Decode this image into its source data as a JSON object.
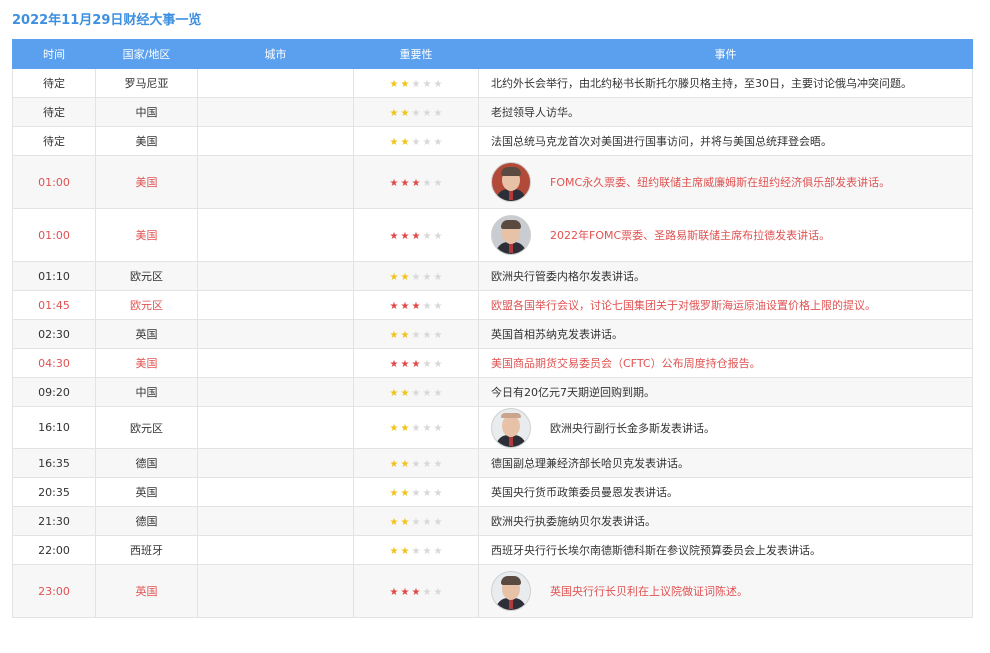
{
  "title": "2022年11月29日财经大事一览",
  "colors": {
    "header_bg": "#5aa0ee",
    "title": "#3d8fe0",
    "important_text": "#e05252",
    "star_low": "#f2c218",
    "star_high": "#e04848"
  },
  "headers": {
    "time": "时间",
    "country": "国家/地区",
    "city": "城市",
    "importance": "重要性",
    "event": "事件"
  },
  "rows": [
    {
      "time": "待定",
      "country": "罗马尼亚",
      "city": "",
      "stars": 2,
      "event": "北约外长会举行，由北约秘书长斯托尔滕贝格主持，至30日，主要讨论俄乌冲突问题。",
      "important": false,
      "avatar": false
    },
    {
      "time": "待定",
      "country": "中国",
      "city": "",
      "stars": 2,
      "event": "老挝领导人访华。",
      "important": false,
      "avatar": false
    },
    {
      "time": "待定",
      "country": "美国",
      "city": "",
      "stars": 2,
      "event": "法国总统马克龙首次对美国进行国事访问，并将与美国总统拜登会晤。",
      "important": false,
      "avatar": false
    },
    {
      "time": "01:00",
      "country": "美国",
      "city": "",
      "stars": 3,
      "event": "FOMC永久票委、纽约联储主席威廉姆斯在纽约经济俱乐部发表讲话。",
      "important": true,
      "avatar": true
    },
    {
      "time": "01:00",
      "country": "美国",
      "city": "",
      "stars": 3,
      "event": "2022年FOMC票委、圣路易斯联储主席布拉德发表讲话。",
      "important": true,
      "avatar": true
    },
    {
      "time": "01:10",
      "country": "欧元区",
      "city": "",
      "stars": 2,
      "event": "欧洲央行管委内格尔发表讲话。",
      "important": false,
      "avatar": false
    },
    {
      "time": "01:45",
      "country": "欧元区",
      "city": "",
      "stars": 3,
      "event": "欧盟各国举行会议，讨论七国集团关于对俄罗斯海运原油设置价格上限的提议。",
      "important": true,
      "avatar": false
    },
    {
      "time": "02:30",
      "country": "英国",
      "city": "",
      "stars": 2,
      "event": "英国首相苏纳克发表讲话。",
      "important": false,
      "avatar": false
    },
    {
      "time": "04:30",
      "country": "美国",
      "city": "",
      "stars": 3,
      "event": "美国商品期货交易委员会（CFTC）公布周度持仓报告。",
      "important": true,
      "avatar": false
    },
    {
      "time": "09:20",
      "country": "中国",
      "city": "",
      "stars": 2,
      "event": "今日有20亿元7天期逆回购到期。",
      "important": false,
      "avatar": false
    },
    {
      "time": "16:10",
      "country": "欧元区",
      "city": "",
      "stars": 2,
      "event": "欧洲央行副行长金多斯发表讲话。",
      "important": false,
      "avatar": true
    },
    {
      "time": "16:35",
      "country": "德国",
      "city": "",
      "stars": 2,
      "event": "德国副总理兼经济部长哈贝克发表讲话。",
      "important": false,
      "avatar": false
    },
    {
      "time": "20:35",
      "country": "英国",
      "city": "",
      "stars": 2,
      "event": "英国央行货币政策委员曼恩发表讲话。",
      "important": false,
      "avatar": false
    },
    {
      "time": "21:30",
      "country": "德国",
      "city": "",
      "stars": 2,
      "event": "欧洲央行执委施纳贝尔发表讲话。",
      "important": false,
      "avatar": false
    },
    {
      "time": "22:00",
      "country": "西班牙",
      "city": "",
      "stars": 2,
      "event": "西班牙央行行长埃尔南德斯德科斯在参议院预算委员会上发表讲话。",
      "important": false,
      "avatar": false
    },
    {
      "time": "23:00",
      "country": "英国",
      "city": "",
      "stars": 3,
      "event": "英国央行行长贝利在上议院做证词陈述。",
      "important": true,
      "avatar": true
    }
  ]
}
